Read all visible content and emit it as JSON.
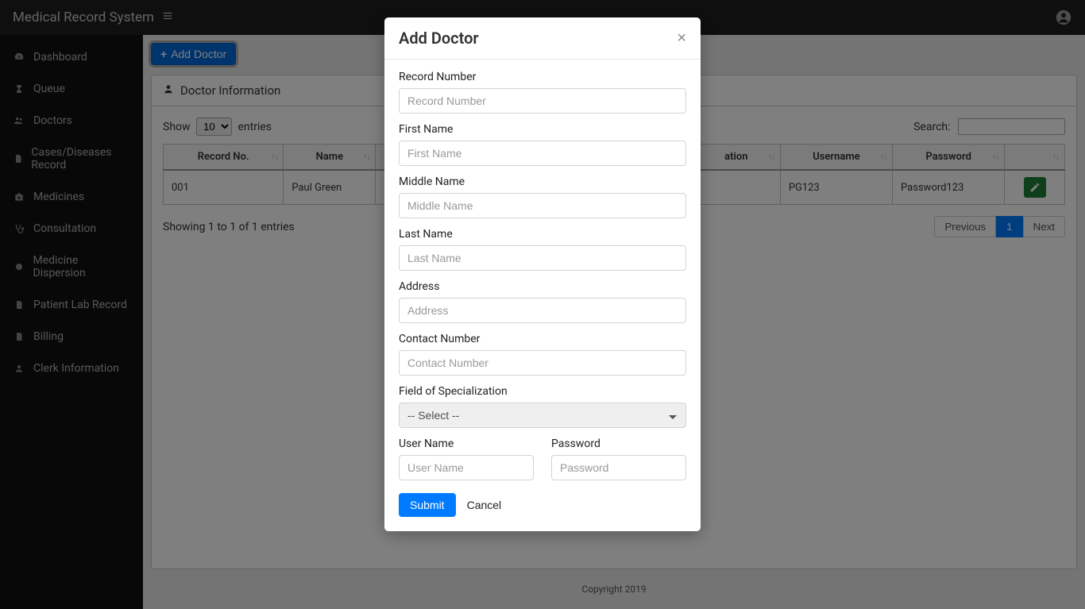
{
  "header": {
    "brand": "Medical Record System"
  },
  "sidebar": {
    "items": [
      {
        "label": "Dashboard",
        "icon": "tachometer"
      },
      {
        "label": "Queue",
        "icon": "hourglass"
      },
      {
        "label": "Doctors",
        "icon": "users"
      },
      {
        "label": "Cases/Diseases Record",
        "icon": "file"
      },
      {
        "label": "Medicines",
        "icon": "medkit"
      },
      {
        "label": "Consultation",
        "icon": "stethoscope"
      },
      {
        "label": "Medicine Dispersion",
        "icon": "circle"
      },
      {
        "label": "Patient Lab Record",
        "icon": "file"
      },
      {
        "label": "Billing",
        "icon": "file"
      },
      {
        "label": "Clerk Information",
        "icon": "user"
      }
    ]
  },
  "page": {
    "add_button": "Add Doctor",
    "card_title": "Doctor Information",
    "show_label_prefix": "Show",
    "show_label_suffix": "entries",
    "show_value": "10",
    "search_label": "Search:",
    "columns": [
      "Record No.",
      "Name",
      "",
      "ation",
      "Username",
      "Password",
      ""
    ],
    "rows": [
      {
        "record_no": "001",
        "name": "Paul Green",
        "username": "PG123",
        "password": "Password123"
      }
    ],
    "info": "Showing 1 to 1 of 1 entries",
    "pagination": {
      "previous": "Previous",
      "page": "1",
      "next": "Next"
    }
  },
  "footer": {
    "text": "Copyright 2019"
  },
  "modal": {
    "title": "Add Doctor",
    "fields": {
      "record_number": {
        "label": "Record Number",
        "placeholder": "Record Number"
      },
      "first_name": {
        "label": "First Name",
        "placeholder": "First Name"
      },
      "middle_name": {
        "label": "Middle Name",
        "placeholder": "Middle Name"
      },
      "last_name": {
        "label": "Last Name",
        "placeholder": "Last Name"
      },
      "address": {
        "label": "Address",
        "placeholder": "Address"
      },
      "contact": {
        "label": "Contact Number",
        "placeholder": "Contact Number"
      },
      "specialization": {
        "label": "Field of Specialization",
        "selected": "-- Select --"
      },
      "username": {
        "label": "User Name",
        "placeholder": "User Name"
      },
      "password": {
        "label": "Password",
        "placeholder": "Password"
      }
    },
    "submit": "Submit",
    "cancel": "Cancel"
  }
}
